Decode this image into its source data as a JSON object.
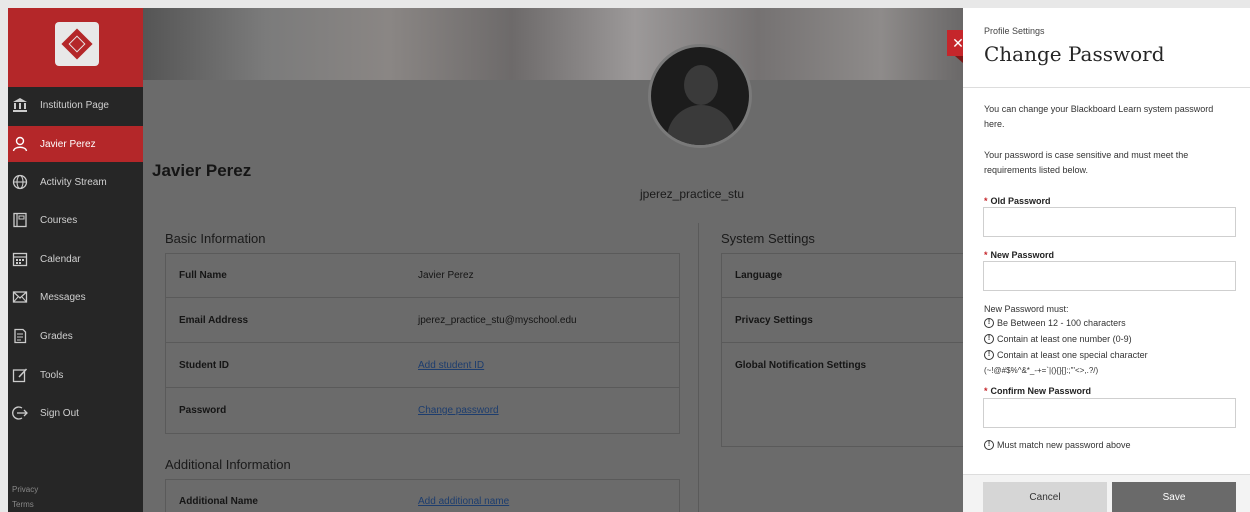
{
  "sidebar": {
    "items": [
      {
        "label": "Institution Page",
        "icon": "institution-icon"
      },
      {
        "label": "Javier Perez",
        "icon": "user-icon"
      },
      {
        "label": "Activity Stream",
        "icon": "globe-icon"
      },
      {
        "label": "Courses",
        "icon": "courses-icon"
      },
      {
        "label": "Calendar",
        "icon": "calendar-icon"
      },
      {
        "label": "Messages",
        "icon": "messages-icon"
      },
      {
        "label": "Grades",
        "icon": "grades-icon"
      },
      {
        "label": "Tools",
        "icon": "tools-icon"
      },
      {
        "label": "Sign Out",
        "icon": "sign-out-icon"
      }
    ],
    "footer": {
      "privacy": "Privacy",
      "terms": "Terms"
    }
  },
  "profile": {
    "name": "Javier Perez",
    "username": "jperez_practice_stu"
  },
  "basic_info": {
    "title": "Basic Information",
    "rows": [
      {
        "label": "Full Name",
        "value": "Javier Perez"
      },
      {
        "label": "Email Address",
        "value": "jperez_practice_stu@myschool.edu"
      },
      {
        "label": "Student ID",
        "value": "Add student ID"
      },
      {
        "label": "Password",
        "value": "Change password"
      }
    ]
  },
  "additional_info": {
    "title": "Additional Information",
    "rows": [
      {
        "label": "Additional Name",
        "value": "Add additional name"
      }
    ]
  },
  "system_settings": {
    "title": "System Settings",
    "rows": [
      {
        "label": "Language"
      },
      {
        "label": "Privacy Settings"
      },
      {
        "label": "Global Notification Settings"
      }
    ]
  },
  "panel": {
    "kicker": "Profile Settings",
    "title": "Change Password",
    "intro": "You can change your Blackboard Learn system password here.",
    "rules_intro": "Your password is case sensitive and must meet the requirements listed below.",
    "old_password_label": "Old Password",
    "new_password_label": "New Password",
    "must_label": "New Password must:",
    "requirements": [
      "Be Between 12 - 100 characters",
      "Contain at least one number (0-9)",
      "Contain at least one special character"
    ],
    "special_chars": "(~!@#$%^&*_-+=`|(){}[]:;\"'<>,.?/)",
    "confirm_label": "Confirm New Password",
    "confirm_hint": "Must match new password above",
    "cancel_label": "Cancel",
    "save_label": "Save"
  },
  "colors": {
    "brand_red": "#b42729",
    "sidebar_bg": "#262626",
    "save_bg": "#6a6a6a"
  }
}
